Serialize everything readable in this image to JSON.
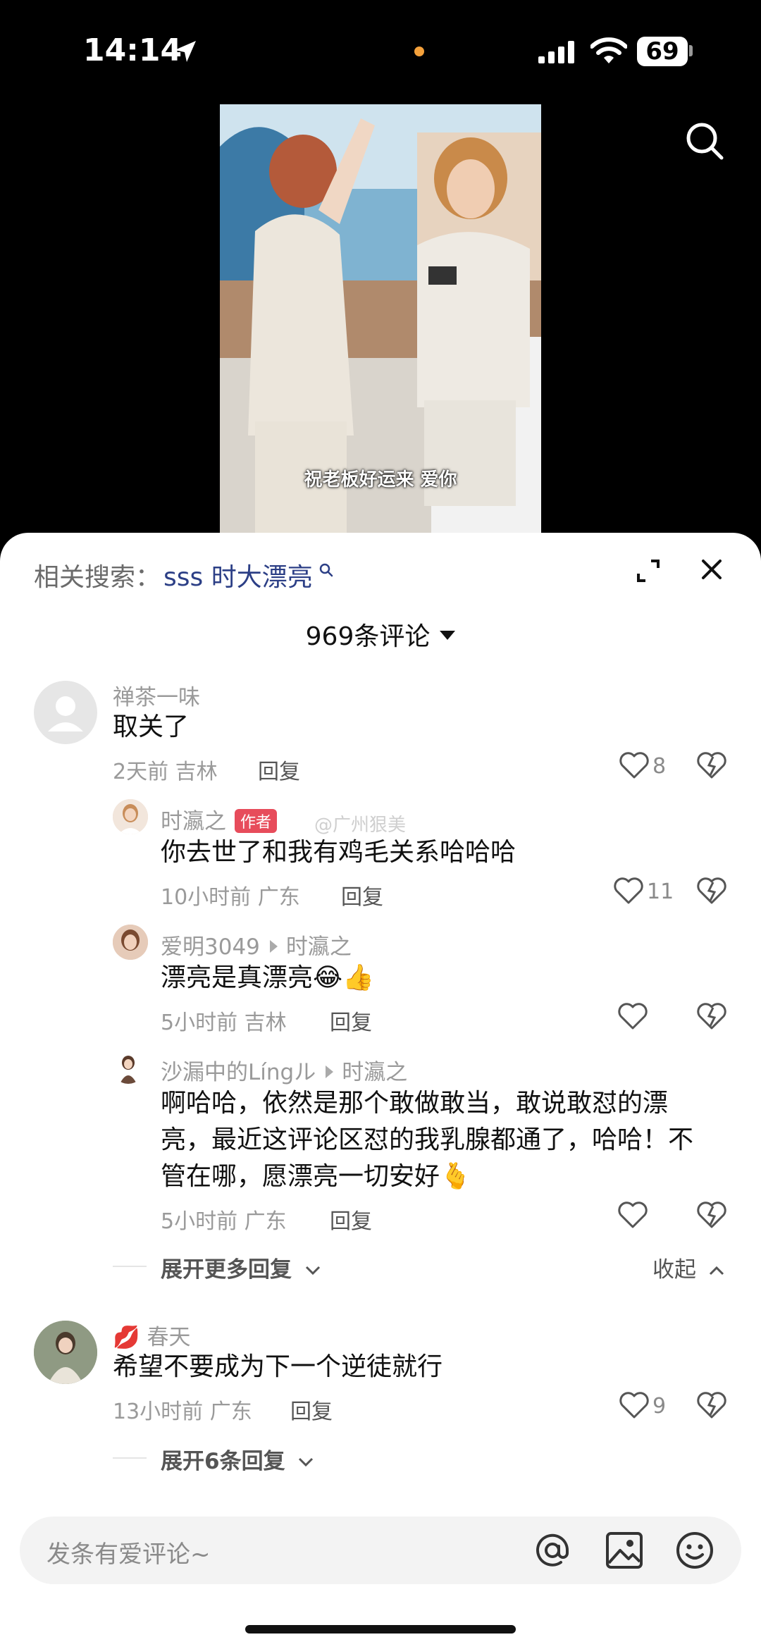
{
  "status_bar": {
    "time": "14:14",
    "battery": "69"
  },
  "video": {
    "caption": "祝老板好运来 爱你"
  },
  "sheet": {
    "related_label": "相关搜索：",
    "related_term": "sss 时大漂亮",
    "comment_count": "969条评论"
  },
  "watermark": "@广州狠美",
  "comments": [
    {
      "user": "禅茶一味",
      "text": "取关了",
      "time": "2天前",
      "location": "吉林",
      "reply": "回复",
      "likes": "8"
    },
    {
      "user": "时瀛之",
      "badge": "作者",
      "text": "你去世了和我有鸡毛关系哈哈哈",
      "time": "10小时前",
      "location": "广东",
      "reply": "回复",
      "likes": "11"
    },
    {
      "user": "爱明3049",
      "reply_to": "时瀛之",
      "text": "漂亮是真漂亮😂👍",
      "time": "5小时前",
      "location": "吉林",
      "reply": "回复"
    },
    {
      "user": "沙漏中的Língル",
      "reply_to": "时瀛之",
      "text_lines": [
        "啊哈哈，依然是那个敢做敢当，敢说敢怼的漂",
        "亮，最近这评论区怼的我乳腺都通了，哈哈！不",
        "管在哪，愿漂亮一切安好🫰"
      ],
      "time": "5小时前",
      "location": "广东",
      "reply": "回复"
    },
    {
      "user": "春天",
      "user_prefix": "💋",
      "text": "希望不要成为下一个逆徒就行",
      "time": "13小时前",
      "location": "广东",
      "reply": "回复",
      "likes": "9"
    }
  ],
  "expand_more": "展开更多回复",
  "collapse": "收起",
  "expand_six": "展开6条回复",
  "input": {
    "placeholder": "发条有爱评论~"
  },
  "colors": {
    "accent_blue": "#2c3f86",
    "author_badge": "#e74c5b"
  }
}
